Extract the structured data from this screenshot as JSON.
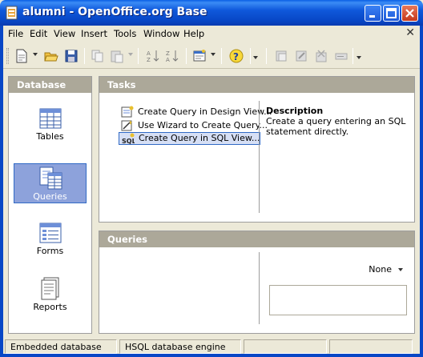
{
  "window": {
    "title": "alumni - OpenOffice.org Base",
    "buttons": [
      "minimize-icon",
      "maximize-icon",
      "close-icon"
    ]
  },
  "menu": {
    "items": [
      "File",
      "Edit",
      "View",
      "Insert",
      "Tools",
      "Window",
      "Help"
    ],
    "close_glyph": "✕"
  },
  "toolbar": {
    "icons": [
      "new-document-icon",
      "open-folder-icon",
      "save-icon",
      "copy-icon",
      "paste-icon",
      "sort-ascending-icon",
      "sort-descending-icon",
      "form-design-icon",
      "help-icon",
      "query-new-icon",
      "query-edit-icon",
      "query-delete-icon",
      "query-rename-icon"
    ]
  },
  "database_pane": {
    "header": "Database",
    "items": [
      {
        "label": "Tables",
        "icon": "tables-icon",
        "selected": false
      },
      {
        "label": "Queries",
        "icon": "queries-icon",
        "selected": true
      },
      {
        "label": "Forms",
        "icon": "forms-icon",
        "selected": false
      },
      {
        "label": "Reports",
        "icon": "reports-icon",
        "selected": false
      }
    ]
  },
  "tasks_pane": {
    "header": "Tasks",
    "tasks": [
      {
        "label": "Create Query in Design View...",
        "icon": "design-view-icon",
        "selected": false
      },
      {
        "label": "Use Wizard to Create Query...",
        "icon": "wizard-icon",
        "selected": false
      },
      {
        "label": "Create Query in SQL View...",
        "icon": "sql-icon",
        "selected": true
      }
    ],
    "description_title": "Description",
    "description_text": "Create a query  entering an SQL statement directly."
  },
  "queries_pane": {
    "header": "Queries",
    "preview_select": "None"
  },
  "status_bar": {
    "cells": [
      "Embedded database",
      "HSQL database engine",
      "",
      "",
      ""
    ]
  },
  "colors": {
    "title_bar": "#0A5FE4",
    "pane_header": "#ACA899",
    "selection": "#8DA2DB",
    "background": "#ECE9D8"
  }
}
